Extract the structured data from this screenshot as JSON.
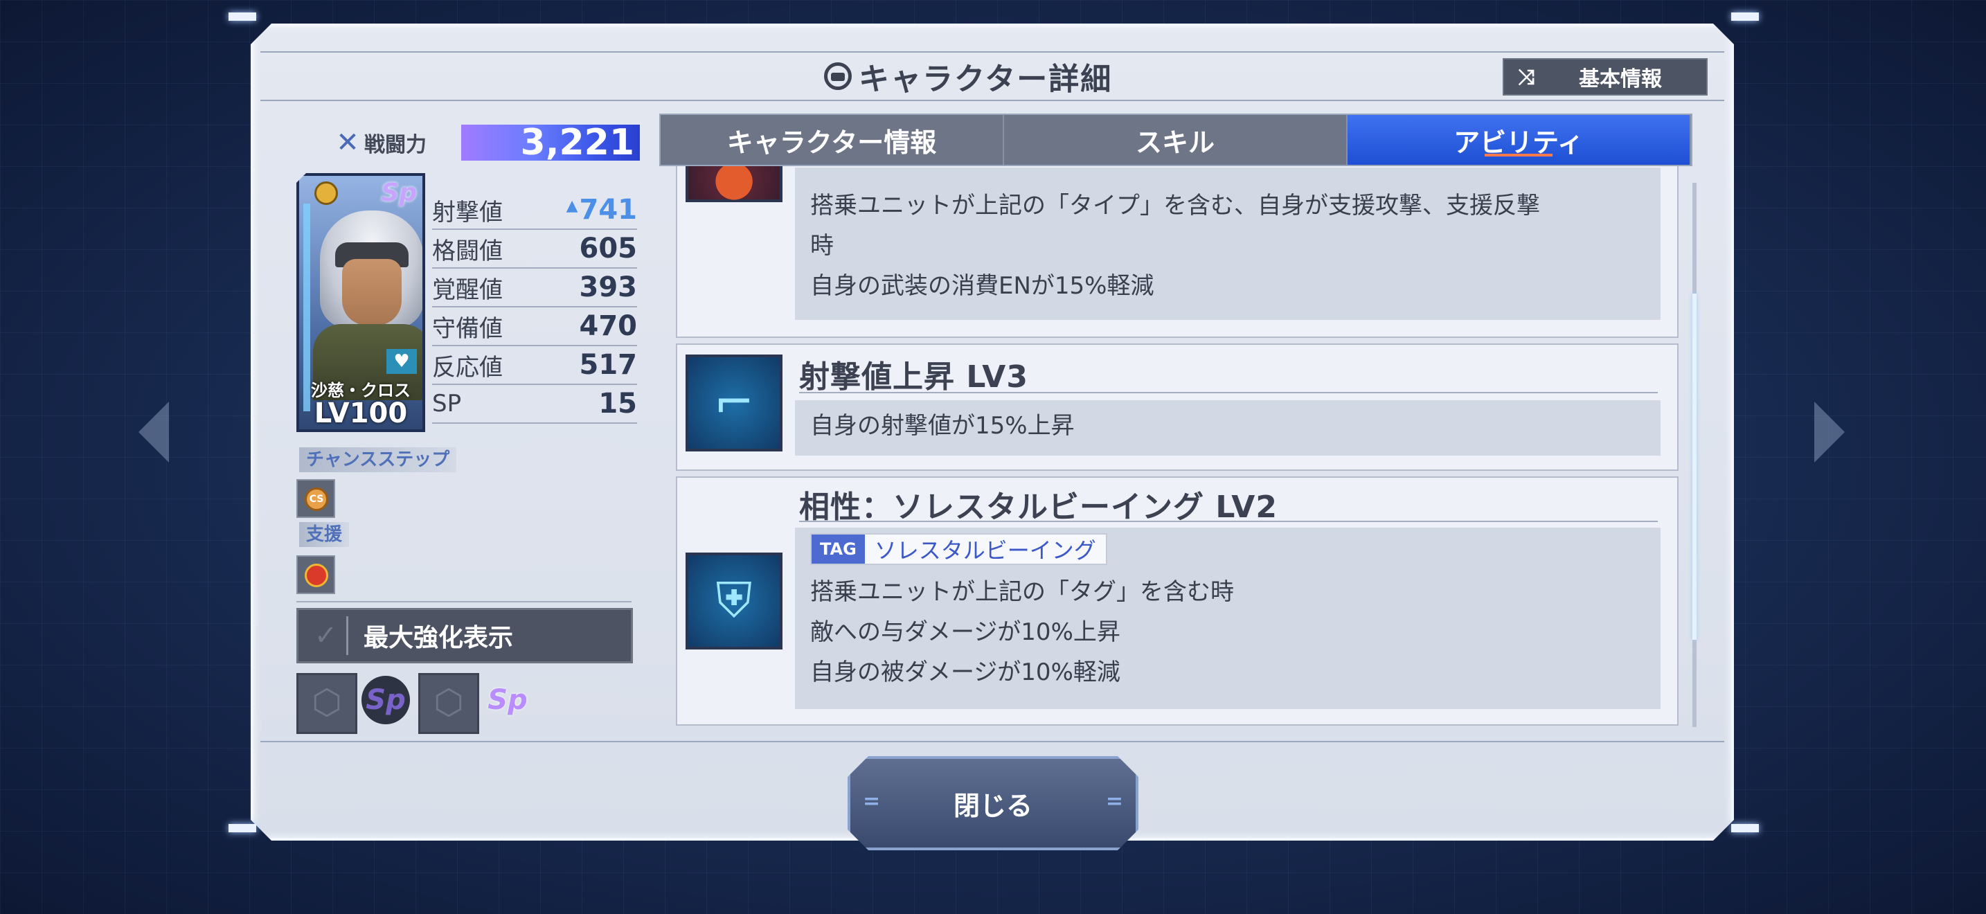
{
  "header": {
    "title": "キャラクター詳細",
    "basic_info_label": "基本情報"
  },
  "left": {
    "power_label": "戦闘力",
    "power_value": "3,221",
    "card": {
      "name": "沙慈・クロス",
      "level": "LV100",
      "sp_badge": "Sp"
    },
    "stats": [
      {
        "label": "射撃値",
        "value": "741"
      },
      {
        "label": "格闘値",
        "value": "605"
      },
      {
        "label": "覚醒値",
        "value": "393"
      },
      {
        "label": "守備値",
        "value": "470"
      },
      {
        "label": "反応値",
        "value": "517"
      },
      {
        "label": "SP",
        "value": "15"
      }
    ],
    "chance_step_label": "チャンスステップ",
    "cs_icon_text": "CS",
    "support_label": "支援",
    "max_enhance_label": "最大強化表示"
  },
  "tabs": [
    {
      "label": "キャラクター情報",
      "active": false
    },
    {
      "label": "スキル",
      "active": false
    },
    {
      "label": "アビリティ",
      "active": true
    }
  ],
  "abilities": [
    {
      "title": "",
      "desc": [
        "搭乗ユニットが上記の「タイプ」を含む、自身が支援攻撃、支援反撃",
        "時",
        "自身の武装の消費ENが15%軽減"
      ]
    },
    {
      "title": "射撃値上昇 LV3",
      "desc": [
        "自身の射撃値が15%上昇"
      ]
    },
    {
      "title": "相性：ソレスタルビーイング LV2",
      "tag_key": "TAG",
      "tag_value": "ソレスタルビーイング",
      "desc": [
        "搭乗ユニットが上記の「タグ」を含む時",
        "敵への与ダメージが10%上昇",
        "自身の被ダメージが10%軽減"
      ]
    }
  ],
  "close_label": "閉じる"
}
